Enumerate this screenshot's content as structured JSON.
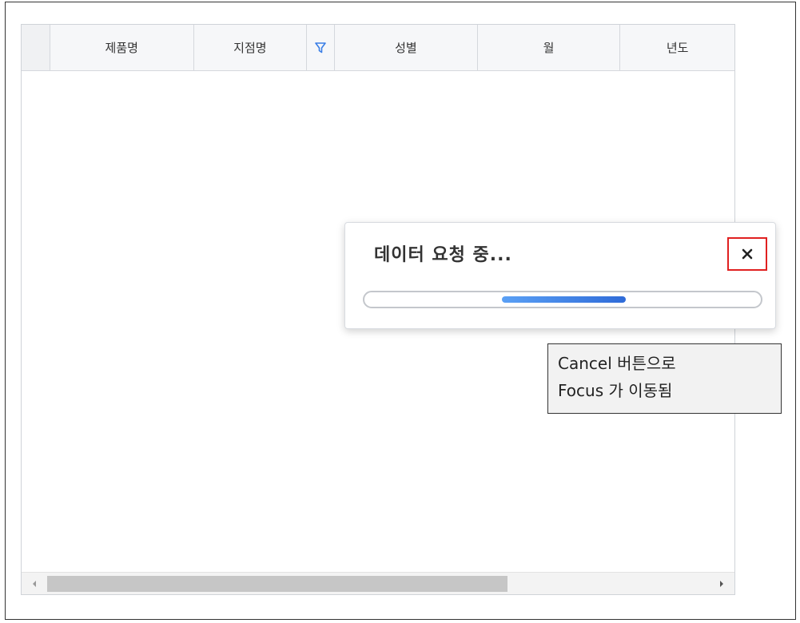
{
  "grid": {
    "columns": [
      "제품명",
      "지점명",
      "성별",
      "월",
      "년도"
    ]
  },
  "loading_dialog": {
    "title": "데이터 요청 중...",
    "progress_fraction": 0.31
  },
  "annotation": {
    "line1": "Cancel 버튼으로",
    "line2": "Focus 가 이동됨"
  },
  "colors": {
    "focus_outline": "#e02020",
    "progress_fill": "#3f82e6",
    "filter_icon": "#3a7ee6"
  },
  "icons": {
    "filter": "filter-icon",
    "close": "close-icon",
    "scroll_left": "arrow-left-icon",
    "scroll_right": "arrow-right-icon"
  }
}
